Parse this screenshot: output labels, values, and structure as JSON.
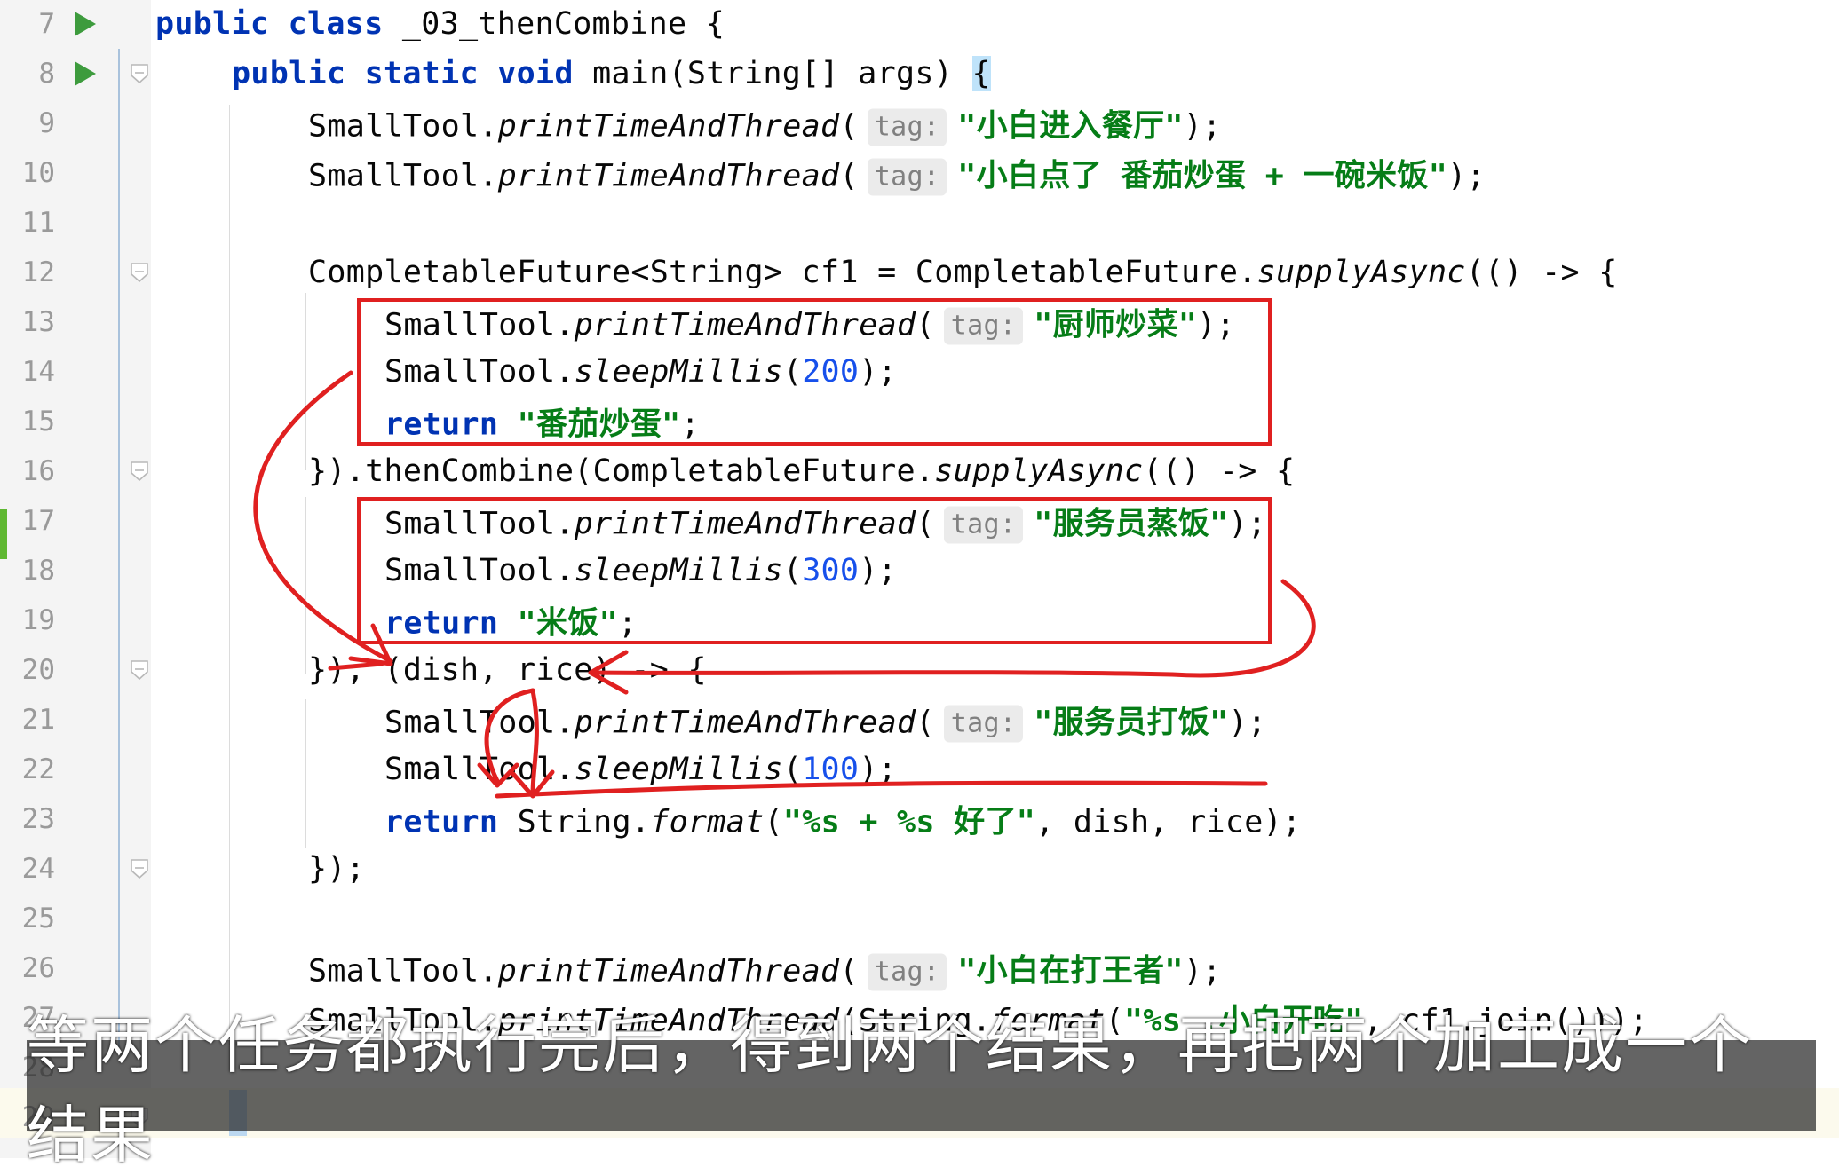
{
  "editor": {
    "class_name": "_03_thenCombine",
    "lines": [
      {
        "n": "7",
        "run": true,
        "fold": false,
        "indent": 0,
        "tokens": [
          {
            "t": "kw",
            "v": "public class "
          },
          {
            "t": "plain",
            "v": "_03_thenCombine {"
          }
        ]
      },
      {
        "n": "8",
        "run": true,
        "fold": true,
        "indent": 1,
        "tokens": [
          {
            "t": "kw",
            "v": "public static void "
          },
          {
            "t": "plain",
            "v": "main(String[] args) "
          },
          {
            "t": "hl",
            "v": "{"
          }
        ]
      },
      {
        "n": "9",
        "indent": 2,
        "tokens": [
          {
            "t": "plain",
            "v": "SmallTool."
          },
          {
            "t": "it",
            "v": "printTimeAndThread"
          },
          {
            "t": "plain",
            "v": "("
          },
          {
            "t": "hint",
            "v": "tag:"
          },
          {
            "t": "str",
            "v": "\"小白进入餐厅\""
          },
          {
            "t": "plain",
            "v": ");"
          }
        ]
      },
      {
        "n": "10",
        "indent": 2,
        "tokens": [
          {
            "t": "plain",
            "v": "SmallTool."
          },
          {
            "t": "it",
            "v": "printTimeAndThread"
          },
          {
            "t": "plain",
            "v": "("
          },
          {
            "t": "hint",
            "v": "tag:"
          },
          {
            "t": "str",
            "v": "\"小白点了 番茄炒蛋 + 一碗米饭\""
          },
          {
            "t": "plain",
            "v": ");"
          }
        ]
      },
      {
        "n": "11",
        "indent": 2,
        "tokens": []
      },
      {
        "n": "12",
        "fold": true,
        "indent": 2,
        "tokens": [
          {
            "t": "plain",
            "v": "CompletableFuture<String> cf1 = CompletableFuture."
          },
          {
            "t": "it",
            "v": "supplyAsync"
          },
          {
            "t": "plain",
            "v": "(() -> {"
          }
        ]
      },
      {
        "n": "13",
        "indent": 3,
        "tokens": [
          {
            "t": "plain",
            "v": "SmallTool."
          },
          {
            "t": "it",
            "v": "printTimeAndThread"
          },
          {
            "t": "plain",
            "v": "("
          },
          {
            "t": "hint",
            "v": "tag:"
          },
          {
            "t": "str",
            "v": "\"厨师炒菜\""
          },
          {
            "t": "plain",
            "v": ");"
          }
        ]
      },
      {
        "n": "14",
        "indent": 3,
        "tokens": [
          {
            "t": "plain",
            "v": "SmallTool."
          },
          {
            "t": "it",
            "v": "sleepMillis"
          },
          {
            "t": "plain",
            "v": "("
          },
          {
            "t": "num",
            "v": "200"
          },
          {
            "t": "plain",
            "v": ");"
          }
        ]
      },
      {
        "n": "15",
        "indent": 3,
        "tokens": [
          {
            "t": "kw",
            "v": "return "
          },
          {
            "t": "str",
            "v": "\"番茄炒蛋\""
          },
          {
            "t": "plain",
            "v": ";"
          }
        ]
      },
      {
        "n": "16",
        "fold": true,
        "indent": 2,
        "tokens": [
          {
            "t": "plain",
            "v": "}).thenCombine(CompletableFuture."
          },
          {
            "t": "it",
            "v": "supplyAsync"
          },
          {
            "t": "plain",
            "v": "(() -> {"
          }
        ]
      },
      {
        "n": "17",
        "indent": 3,
        "tokens": [
          {
            "t": "plain",
            "v": "SmallTool."
          },
          {
            "t": "it",
            "v": "printTimeAndThread"
          },
          {
            "t": "plain",
            "v": "("
          },
          {
            "t": "hint",
            "v": "tag:"
          },
          {
            "t": "str",
            "v": "\"服务员蒸饭\""
          },
          {
            "t": "plain",
            "v": ");"
          }
        ]
      },
      {
        "n": "18",
        "indent": 3,
        "tokens": [
          {
            "t": "plain",
            "v": "SmallTool."
          },
          {
            "t": "it",
            "v": "sleepMillis"
          },
          {
            "t": "plain",
            "v": "("
          },
          {
            "t": "num",
            "v": "300"
          },
          {
            "t": "plain",
            "v": ");"
          }
        ]
      },
      {
        "n": "19",
        "indent": 3,
        "tokens": [
          {
            "t": "kw",
            "v": "return "
          },
          {
            "t": "str",
            "v": "\"米饭\""
          },
          {
            "t": "plain",
            "v": ";"
          }
        ]
      },
      {
        "n": "20",
        "fold": true,
        "indent": 2,
        "tokens": [
          {
            "t": "plain",
            "v": "}), (dish, rice) -> {"
          }
        ]
      },
      {
        "n": "21",
        "indent": 3,
        "tokens": [
          {
            "t": "plain",
            "v": "SmallTool."
          },
          {
            "t": "it",
            "v": "printTimeAndThread"
          },
          {
            "t": "plain",
            "v": "("
          },
          {
            "t": "hint",
            "v": "tag:"
          },
          {
            "t": "str",
            "v": "\"服务员打饭\""
          },
          {
            "t": "plain",
            "v": ");"
          }
        ]
      },
      {
        "n": "22",
        "indent": 3,
        "tokens": [
          {
            "t": "plain",
            "v": "SmallTool."
          },
          {
            "t": "it",
            "v": "sleepMillis"
          },
          {
            "t": "plain",
            "v": "("
          },
          {
            "t": "num",
            "v": "100"
          },
          {
            "t": "plain",
            "v": ");"
          }
        ]
      },
      {
        "n": "23",
        "indent": 3,
        "tokens": [
          {
            "t": "kw",
            "v": "return "
          },
          {
            "t": "plain",
            "v": "String."
          },
          {
            "t": "it",
            "v": "format"
          },
          {
            "t": "plain",
            "v": "("
          },
          {
            "t": "str",
            "v": "\"%s + %s 好了\""
          },
          {
            "t": "plain",
            "v": ", dish, rice);"
          }
        ]
      },
      {
        "n": "24",
        "fold": true,
        "indent": 2,
        "tokens": [
          {
            "t": "plain",
            "v": "});"
          }
        ]
      },
      {
        "n": "25",
        "indent": 2,
        "tokens": []
      },
      {
        "n": "26",
        "indent": 2,
        "tokens": [
          {
            "t": "plain",
            "v": "SmallTool."
          },
          {
            "t": "it",
            "v": "printTimeAndThread"
          },
          {
            "t": "plain",
            "v": "("
          },
          {
            "t": "hint",
            "v": "tag:"
          },
          {
            "t": "str",
            "v": "\"小白在打王者\""
          },
          {
            "t": "plain",
            "v": ");"
          }
        ]
      },
      {
        "n": "27",
        "indent": 2,
        "tokens": [
          {
            "t": "plain",
            "v": "SmallTool."
          },
          {
            "t": "it",
            "v": "printTimeAndThread"
          },
          {
            "t": "plain",
            "v": "(String."
          },
          {
            "t": "it",
            "v": "format"
          },
          {
            "t": "plain",
            "v": "("
          },
          {
            "t": "str",
            "v": "\"%s ,小白开吃\""
          },
          {
            "t": "plain",
            "v": ", cf1.join()));"
          }
        ]
      },
      {
        "n": "28",
        "indent": 2,
        "tokens": []
      },
      {
        "n": "29",
        "fold": true,
        "indent": 1,
        "tokens": []
      }
    ]
  },
  "subtitle": {
    "text": "等两个任务都执行完后，得到两个结果，再把两个加工成一个结果"
  },
  "colors": {
    "keyword": "#0033b3",
    "string": "#067d17",
    "number": "#1750eb",
    "annotation_red": "#e02020",
    "run_icon": "#3d9b3d"
  },
  "icons": {
    "run": "run-triangle-icon",
    "fold": "fold-marker-icon"
  }
}
